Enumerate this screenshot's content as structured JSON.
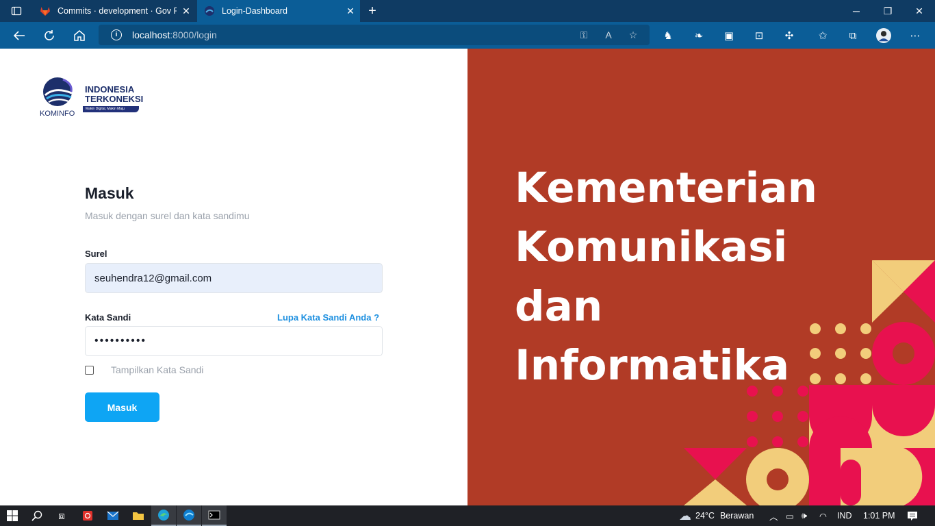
{
  "browser": {
    "tabs": [
      {
        "title": "Commits · development · Gov Re",
        "active": false
      },
      {
        "title": "Login-Dashboard",
        "active": true
      }
    ],
    "new_tab_icon": "plus-icon",
    "window_controls": [
      "minimize-icon",
      "restore-icon",
      "close-icon"
    ],
    "url_host": "localhost",
    "url_path": ":8000/login",
    "accent": "#0b5d97"
  },
  "logo": {
    "brand_line1": "INDONESIA",
    "brand_line2": "TERKONEKSI",
    "tagline": "Makin Digital, Makin Maju",
    "caption": "KOMINFO"
  },
  "form": {
    "title": "Masuk",
    "subtitle": "Masuk dengan surel dan kata sandimu",
    "email_label": "Surel",
    "email_value": "seuhendra12@gmail.com",
    "password_label": "Kata Sandi",
    "password_value": "••••••••••",
    "forgot_label": "Lupa Kata Sandi Anda ?",
    "show_password_label": "Tampilkan Kata Sandi",
    "submit_label": "Masuk",
    "submit_color": "#0ea5f4"
  },
  "hero": {
    "lines": [
      "Kementerian",
      "Komunikasi",
      "dan",
      "Informatika"
    ],
    "background": "#b13b26"
  },
  "taskbar": {
    "weather_temp": "24°C",
    "weather_desc": "Berawan",
    "language": "IND",
    "time": "1:01 PM"
  }
}
